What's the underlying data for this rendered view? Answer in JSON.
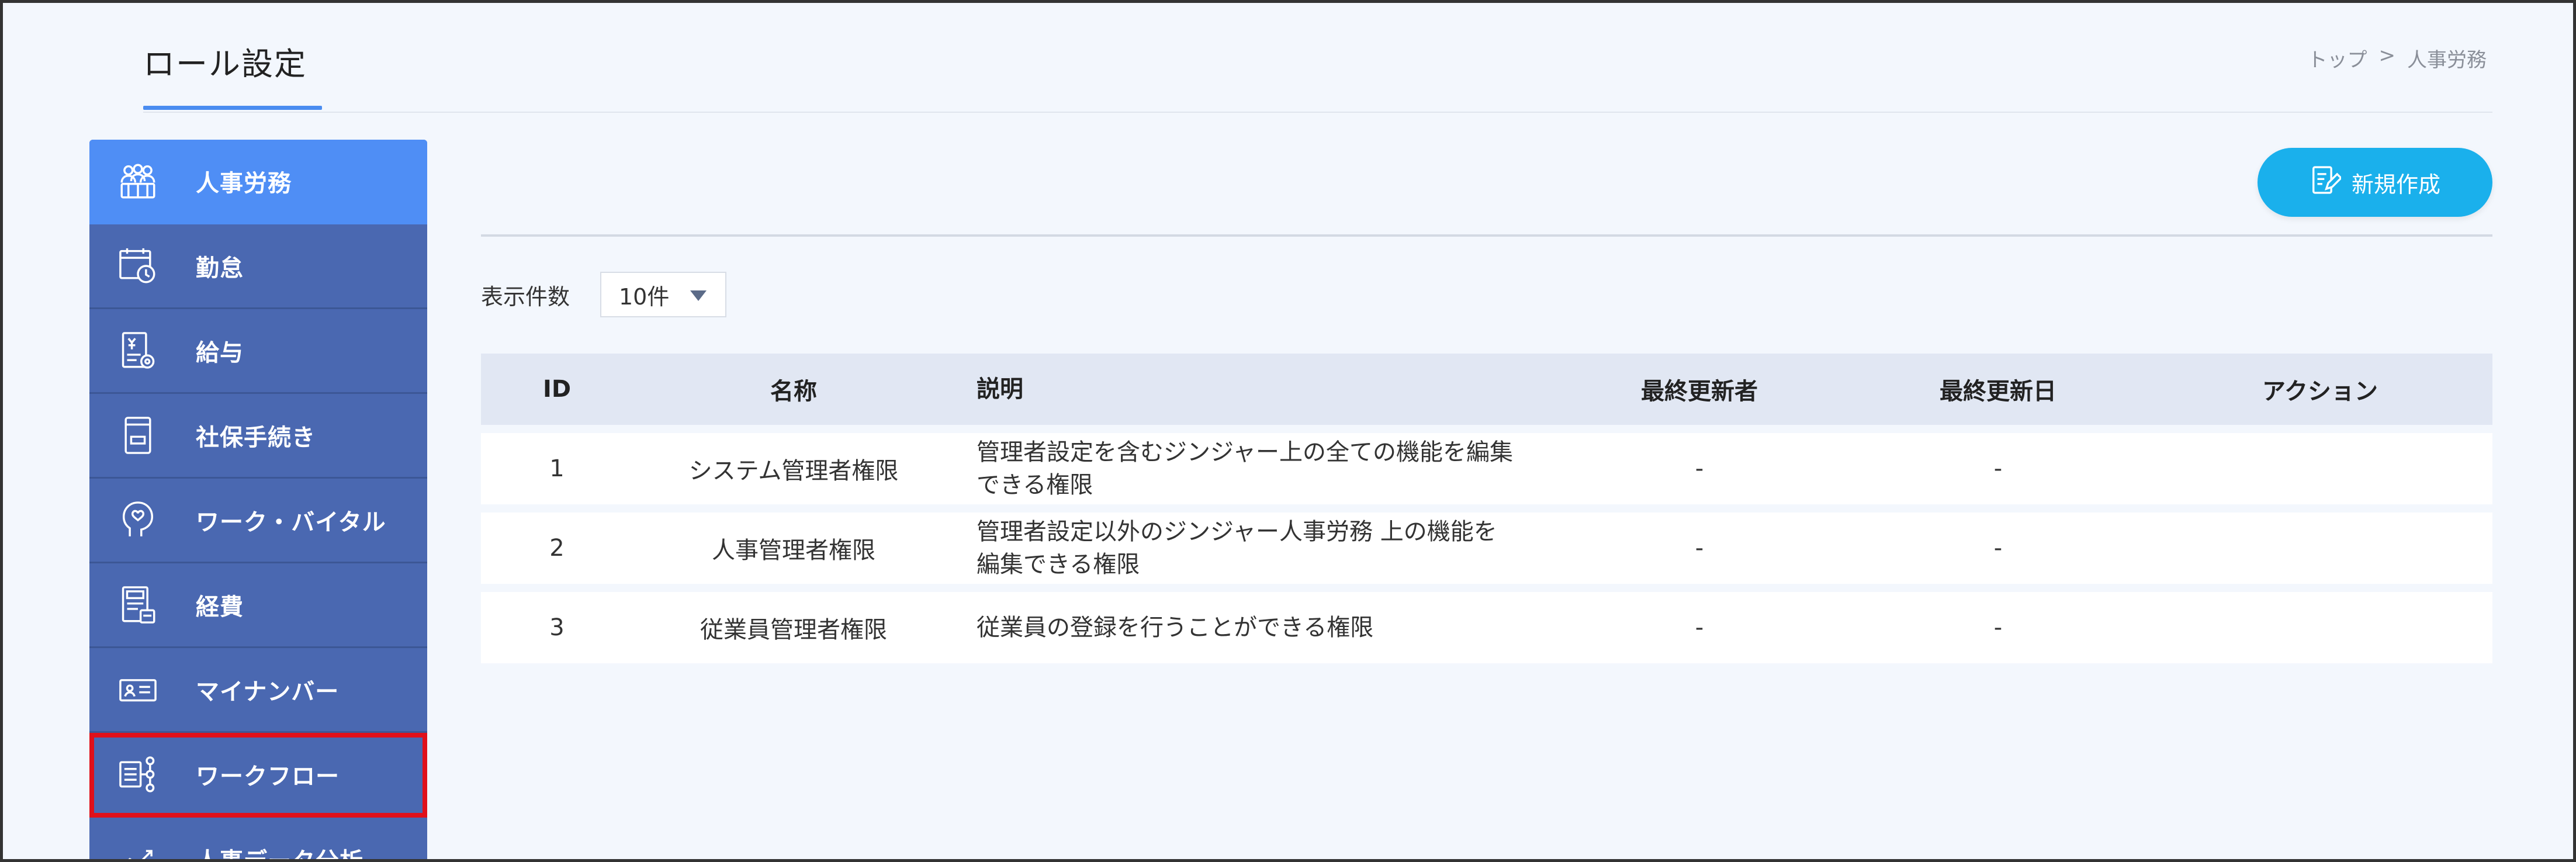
{
  "header": {
    "title": "ロール設定",
    "breadcrumb": [
      "トップ",
      ">",
      "人事労務"
    ]
  },
  "sidebar": {
    "items": [
      {
        "label": "人事労務",
        "icon": "people-icon",
        "active": true
      },
      {
        "label": "勤怠",
        "icon": "calendar-clock-icon"
      },
      {
        "label": "給与",
        "icon": "payslip-icon"
      },
      {
        "label": "社保手続き",
        "icon": "document-tray-icon"
      },
      {
        "label": "ワーク・バイタル",
        "icon": "head-heart-icon"
      },
      {
        "label": "経費",
        "icon": "receipt-icon"
      },
      {
        "label": "マイナンバー",
        "icon": "id-card-icon"
      },
      {
        "label": "ワークフロー",
        "icon": "workflow-icon",
        "highlighted": true
      },
      {
        "label": "人事データ分析",
        "icon": "chart-trend-icon"
      }
    ]
  },
  "toolbar": {
    "new_label": "新規作成"
  },
  "pager": {
    "count_label": "表示件数",
    "count_value": "10件"
  },
  "table": {
    "columns": [
      "ID",
      "名称",
      "説明",
      "最終更新者",
      "最終更新日",
      "アクション"
    ],
    "rows": [
      {
        "id": "1",
        "name": "システム管理者権限",
        "desc_line1": "管理者設定を含むジンジャー上の全ての機能を編集",
        "desc_line2": "できる権限",
        "updater": "-",
        "updated": "-",
        "action": ""
      },
      {
        "id": "2",
        "name": "人事管理者権限",
        "desc_line1": "管理者設定以外のジンジャー人事労務 上の機能を",
        "desc_line2": "編集できる権限",
        "updater": "-",
        "updated": "-",
        "action": ""
      },
      {
        "id": "3",
        "name": "従業員管理者権限",
        "desc_line1": "従業員の登録を行うことができる権限",
        "desc_line2": "",
        "updater": "-",
        "updated": "-",
        "action": ""
      }
    ]
  },
  "colors": {
    "accent": "#4f8ef5",
    "sidebar": "#4a68b1",
    "button": "#1ab0ec",
    "highlight": "#e0101a"
  }
}
